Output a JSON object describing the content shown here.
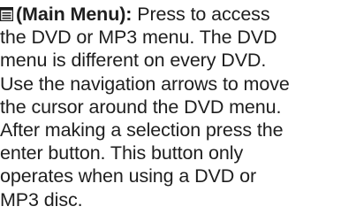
{
  "entry": {
    "icon": "menu-list-icon",
    "term": "(Main Menu):",
    "lines": [
      " Press to access",
      "the DVD or MP3 menu. The DVD",
      "menu is different on every DVD.",
      "Use the navigation arrows to move",
      "the cursor around the DVD menu.",
      "After making a selection press the",
      "enter button. This button only",
      "operates when using a DVD or",
      "MP3 disc."
    ]
  }
}
